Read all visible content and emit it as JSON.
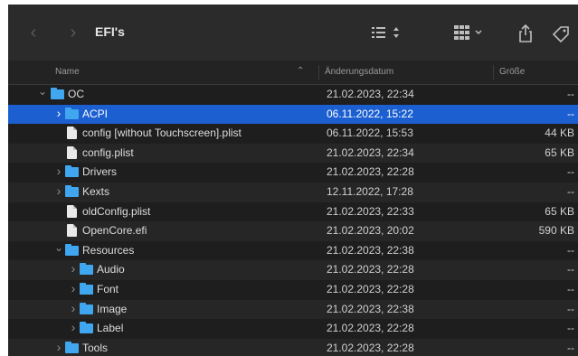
{
  "window": {
    "title": "EFI's"
  },
  "toolbar": {
    "back_icon": "chevron-left-icon",
    "forward_icon": "chevron-right-icon",
    "list_view_icon": "list-icon",
    "group_icon": "grid-icon",
    "share_icon": "share-icon",
    "tag_icon": "tag-icon"
  },
  "columns": {
    "name": "Name",
    "date": "Änderungsdatum",
    "size": "Größe"
  },
  "rows": [
    {
      "name": "OC",
      "date": "21.02.2023, 22:34",
      "size": "--",
      "type": "folder",
      "depth": 0,
      "expanded": true
    },
    {
      "name": "ACPI",
      "date": "06.11.2022, 15:22",
      "size": "--",
      "type": "folder",
      "depth": 1,
      "expanded": false,
      "selected": true
    },
    {
      "name": "config [without Touchscreen].plist",
      "date": "06.11.2022, 15:53",
      "size": "44 KB",
      "type": "file",
      "depth": 1
    },
    {
      "name": "config.plist",
      "date": "21.02.2023, 22:34",
      "size": "65 KB",
      "type": "file",
      "depth": 1
    },
    {
      "name": "Drivers",
      "date": "21.02.2023, 22:28",
      "size": "--",
      "type": "folder",
      "depth": 1,
      "expanded": false
    },
    {
      "name": "Kexts",
      "date": "12.11.2022, 17:28",
      "size": "--",
      "type": "folder",
      "depth": 1,
      "expanded": false
    },
    {
      "name": "oldConfig.plist",
      "date": "21.02.2023, 22:33",
      "size": "65 KB",
      "type": "file",
      "depth": 1
    },
    {
      "name": "OpenCore.efi",
      "date": "21.02.2023, 20:02",
      "size": "590 KB",
      "type": "file",
      "depth": 1
    },
    {
      "name": "Resources",
      "date": "21.02.2023, 22:38",
      "size": "--",
      "type": "folder",
      "depth": 1,
      "expanded": true
    },
    {
      "name": "Audio",
      "date": "21.02.2023, 22:28",
      "size": "--",
      "type": "folder",
      "depth": 2,
      "expanded": false
    },
    {
      "name": "Font",
      "date": "21.02.2023, 22:28",
      "size": "--",
      "type": "folder",
      "depth": 2,
      "expanded": false
    },
    {
      "name": "Image",
      "date": "21.02.2023, 22:38",
      "size": "--",
      "type": "folder",
      "depth": 2,
      "expanded": false
    },
    {
      "name": "Label",
      "date": "21.02.2023, 22:28",
      "size": "--",
      "type": "folder",
      "depth": 2,
      "expanded": false
    },
    {
      "name": "Tools",
      "date": "21.02.2023, 22:28",
      "size": "--",
      "type": "folder",
      "depth": 1,
      "expanded": false
    }
  ],
  "colors": {
    "selection": "#1b5fd1",
    "folder": "#3fa6ef"
  }
}
